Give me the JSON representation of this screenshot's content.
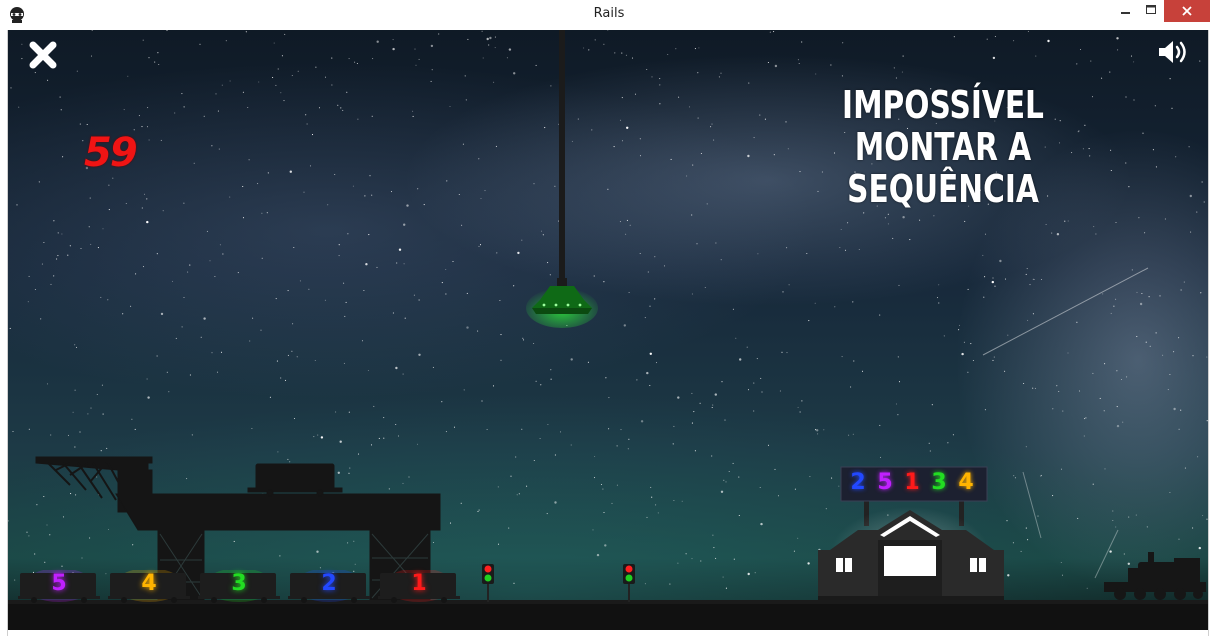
{
  "window": {
    "title": "Rails"
  },
  "hud": {
    "close_icon": "x-icon",
    "sound_icon": "speaker-on-icon",
    "timer": "59",
    "timer_color": "#f01414",
    "message_line1": "IMPOSSÍVEL",
    "message_line2": "MONTAR A SEQUÊNCIA"
  },
  "claw": {
    "state": "empty",
    "light_color": "#2bd23a"
  },
  "wagons": [
    {
      "number": "5",
      "color": "#c020ff"
    },
    {
      "number": "4",
      "color": "#ffb400"
    },
    {
      "number": "3",
      "color": "#22dd22"
    },
    {
      "number": "2",
      "color": "#2248ff"
    },
    {
      "number": "1",
      "color": "#ff1a1a"
    }
  ],
  "target_sequence": [
    {
      "digit": "2",
      "color": "#2248ff"
    },
    {
      "digit": "5",
      "color": "#c020ff"
    },
    {
      "digit": "1",
      "color": "#ff1a1a"
    },
    {
      "digit": "3",
      "color": "#22dd22"
    },
    {
      "digit": "4",
      "color": "#ffb400"
    }
  ],
  "signals": [
    {
      "red_light": "#ff2020",
      "green_light": "#20d020"
    },
    {
      "red_light": "#ff2020",
      "green_light": "#20d020"
    }
  ]
}
